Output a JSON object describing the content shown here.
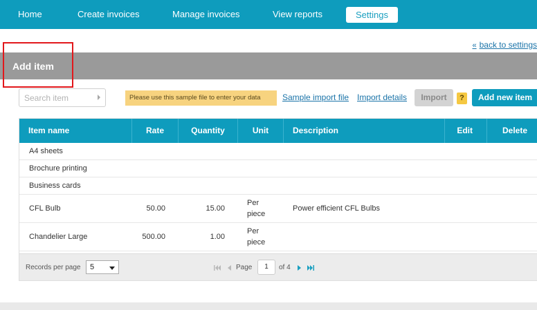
{
  "nav": {
    "items": [
      {
        "label": "Home"
      },
      {
        "label": "Create invoices"
      },
      {
        "label": "Manage invoices"
      },
      {
        "label": "View reports"
      },
      {
        "label": "Settings",
        "active": true
      }
    ]
  },
  "back_link": {
    "label": "back to settings"
  },
  "page_title": "Add item",
  "search": {
    "placeholder": "Search item",
    "value": ""
  },
  "toolbar": {
    "sample_note": "Please use this sample file to enter your data",
    "sample_import_file": "Sample import file",
    "import_details": "Import details",
    "import_label": "Import",
    "help_label": "?",
    "add_new_item": "Add new item"
  },
  "table": {
    "columns": [
      "Item name",
      "Rate",
      "Quantity",
      "Unit",
      "Description",
      "Edit",
      "Delete"
    ],
    "rows": [
      {
        "name": "A4 sheets",
        "rate": "",
        "qty": "",
        "unit_line1": "",
        "unit_line2": "",
        "desc": ""
      },
      {
        "name": "Brochure printing",
        "rate": "",
        "qty": "",
        "unit_line1": "",
        "unit_line2": "",
        "desc": ""
      },
      {
        "name": "Business cards",
        "rate": "",
        "qty": "",
        "unit_line1": "",
        "unit_line2": "",
        "desc": ""
      },
      {
        "name": "CFL Bulb",
        "rate": "50.00",
        "qty": "15.00",
        "unit_line1": "Per",
        "unit_line2": "piece",
        "desc": "Power efficient CFL Bulbs"
      },
      {
        "name": "Chandelier Large",
        "rate": "500.00",
        "qty": "1.00",
        "unit_line1": "Per",
        "unit_line2": "piece",
        "desc": ""
      }
    ]
  },
  "pager": {
    "records_per_page_label": "Records per page",
    "records_per_page_value": "5",
    "page_label": "Page",
    "current_page": "1",
    "of_label": "of 4"
  },
  "colors": {
    "accent": "#0e9cbd",
    "title_bar": "#9a9a9a",
    "highlight_box": "#e2171b",
    "note_bg": "#f7d37f"
  },
  "icons": [
    "chevron-right-icon",
    "double-chevron-left-icon",
    "first-page-icon",
    "prev-page-icon",
    "next-page-icon",
    "last-page-icon",
    "dropdown-caret-icon",
    "help-icon"
  ]
}
